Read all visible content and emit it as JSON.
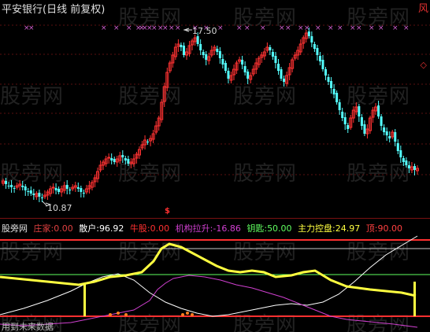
{
  "header": {
    "title": "平安银行(日线 前复权)",
    "corner": "风"
  },
  "chart": {
    "high_label": "17.50",
    "low_label": "10.87",
    "signal_label": "$",
    "side_marker": "◇"
  },
  "indicator": {
    "name": "股旁网",
    "items": [
      {
        "label": "庄家:",
        "value": "0.00",
        "label_color": "#e04040",
        "value_color": "#e04040"
      },
      {
        "label": "散户:",
        "value": "96.92",
        "label_color": "#ffffff",
        "value_color": "#ffffff"
      },
      {
        "label": "牛股:",
        "value": "0.00",
        "label_color": "#ff3030",
        "value_color": "#ff3030"
      },
      {
        "label": "机构拉升:",
        "value": "-16.86",
        "label_color": "#d040d0",
        "value_color": "#d040d0"
      },
      {
        "label": "钥匙:",
        "value": "50.00",
        "label_color": "#60ff60",
        "value_color": "#60ff60"
      },
      {
        "label": "主力控盘:",
        "value": "24.97",
        "label_color": "#ffff40",
        "value_color": "#ffff40"
      },
      {
        "label": "顶:",
        "value": "90.00",
        "label_color": "#ff4040",
        "value_color": "#ff4040"
      }
    ]
  },
  "footer": {
    "text": "用到未来数据"
  },
  "watermark": "股旁网",
  "colors": {
    "background": "#000000",
    "up_candle": "#ff3232",
    "down_candle": "#54ffff",
    "top_line": "#ff3030",
    "key_line": "#60ff60",
    "control_line": "#ffff40",
    "retail_line": "#ffffff",
    "inst_line": "#d040d0"
  }
}
